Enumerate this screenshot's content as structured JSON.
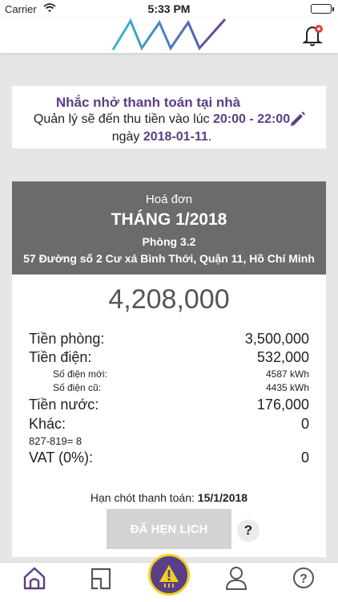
{
  "status_bar": {
    "carrier": "Carrier",
    "time": "5:33 PM"
  },
  "reminder": {
    "title": "Nhắc nhở thanh toán tại nhà",
    "text_1": "Quản lý sẽ đến thu tiền vào lúc ",
    "time_range": "20:00 - 22:00",
    "text_2": " ngày ",
    "date": "2018-01-11",
    "text_3": "."
  },
  "invoice": {
    "label": "Hoá đơn",
    "month": "THÁNG 1/2018",
    "room": "Phòng 3.2",
    "address": "57 Đường số 2 Cư xá Bình Thới, Quận 11, Hồ Chí Minh",
    "total": "4,208,000",
    "lines": {
      "rent": {
        "label": "Tiền phòng:",
        "value": "3,500,000"
      },
      "electricity": {
        "label": "Tiền điện:",
        "value": "532,000"
      },
      "meter_new": {
        "label": "Số điện mới:",
        "value": "4587 kWh"
      },
      "meter_old": {
        "label": "Số điện cũ:",
        "value": "4435 kWh"
      },
      "water": {
        "label": "Tiền nước:",
        "value": "176,000"
      },
      "other": {
        "label": "Khác:",
        "value": "0"
      },
      "other_note": "827-819= 8",
      "vat": {
        "label": "VAT (0%):",
        "value": "0"
      }
    },
    "deadline_label": "Hạn chót thanh toán: ",
    "deadline_date": "15/1/2018",
    "schedule_button": "ĐÃ HẸN LỊCH",
    "help_button": "?"
  },
  "colors": {
    "brand_purple": "#5b3f86",
    "header_gray": "#6b6b6b",
    "accent_yellow": "#f1d21d",
    "logo_teal": "#3fb6c9"
  },
  "icons": [
    "wifi-icon",
    "battery-icon",
    "logo",
    "bell-icon",
    "edit-icon",
    "home-icon",
    "room-icon",
    "alert-icon",
    "profile-icon",
    "help-icon"
  ]
}
